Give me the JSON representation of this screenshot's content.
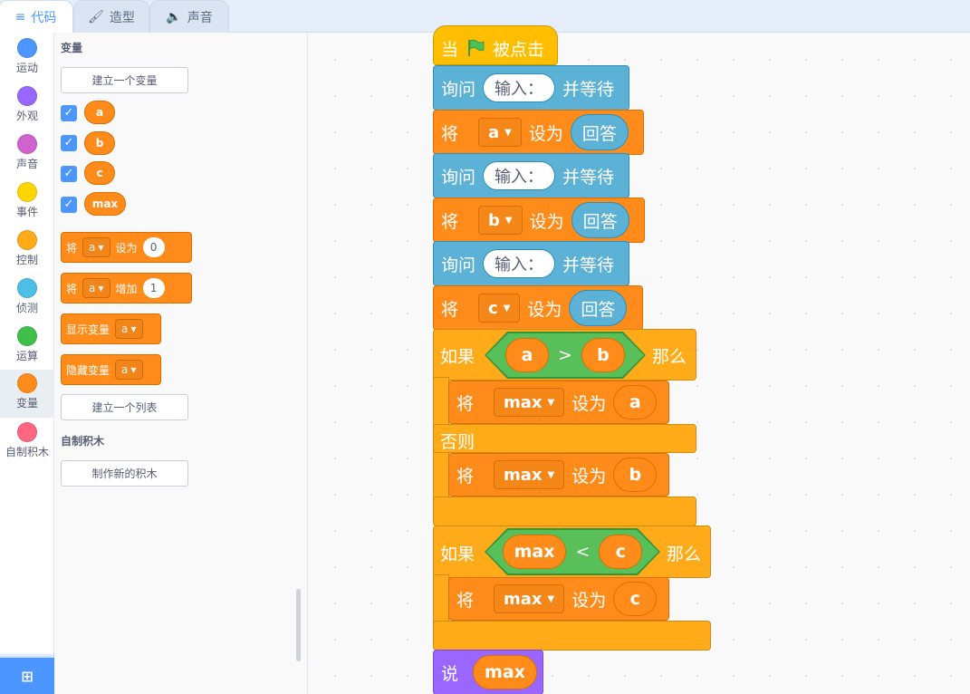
{
  "tabs": [
    {
      "label": "代码",
      "icon": "code-icon"
    },
    {
      "label": "造型",
      "icon": "brush-icon"
    },
    {
      "label": "声音",
      "icon": "speaker-icon"
    }
  ],
  "categories": [
    {
      "label": "运动",
      "color": "#4c97ff"
    },
    {
      "label": "外观",
      "color": "#9966ff"
    },
    {
      "label": "声音",
      "color": "#cf63cf"
    },
    {
      "label": "事件",
      "color": "#ffd500"
    },
    {
      "label": "控制",
      "color": "#ffab19"
    },
    {
      "label": "侦测",
      "color": "#4cbfe6"
    },
    {
      "label": "运算",
      "color": "#40bf4a"
    },
    {
      "label": "变量",
      "color": "#ff8c1a"
    },
    {
      "label": "自制积木",
      "color": "#ff6680"
    }
  ],
  "palette": {
    "section_variables": "变量",
    "make_variable": "建立一个变量",
    "variables": [
      "a",
      "b",
      "c",
      "max"
    ],
    "check_mark": "✓",
    "set_block": {
      "verb": "将",
      "var": "a",
      "op": "设为",
      "value": "0"
    },
    "change_block": {
      "verb": "将",
      "var": "a",
      "op": "增加",
      "value": "1"
    },
    "show_block": {
      "label": "显示变量",
      "var": "a"
    },
    "hide_block": {
      "label": "隐藏变量",
      "var": "a"
    },
    "make_list": "建立一个列表",
    "section_custom": "自制积木",
    "make_block": "制作新的积木"
  },
  "script": {
    "hat": {
      "when": "当",
      "clicked": "被点击"
    },
    "ask1": {
      "verb": "询问",
      "input": "输入：",
      "wait": "并等待"
    },
    "set_a": {
      "verb": "将",
      "var": "a",
      "op": "设为",
      "value": "回答"
    },
    "ask2": {
      "verb": "询问",
      "input": "输入：",
      "wait": "并等待"
    },
    "set_b": {
      "verb": "将",
      "var": "b",
      "op": "设为",
      "value": "回答"
    },
    "ask3": {
      "verb": "询问",
      "input": "输入：",
      "wait": "并等待"
    },
    "set_c": {
      "verb": "将",
      "var": "c",
      "op": "设为",
      "value": "回答"
    },
    "if1": {
      "if": "如果",
      "left": "a",
      "operator": ">",
      "right": "b",
      "then": "那么",
      "else": "否则"
    },
    "if1_then": {
      "verb": "将",
      "var": "max",
      "op": "设为",
      "value": "a"
    },
    "if1_else": {
      "verb": "将",
      "var": "max",
      "op": "设为",
      "value": "b"
    },
    "if2": {
      "if": "如果",
      "left": "max",
      "operator": "<",
      "right": "c",
      "then": "那么"
    },
    "if2_then": {
      "verb": "将",
      "var": "max",
      "op": "设为",
      "value": "c"
    },
    "say": {
      "verb": "说",
      "value": "max"
    }
  }
}
